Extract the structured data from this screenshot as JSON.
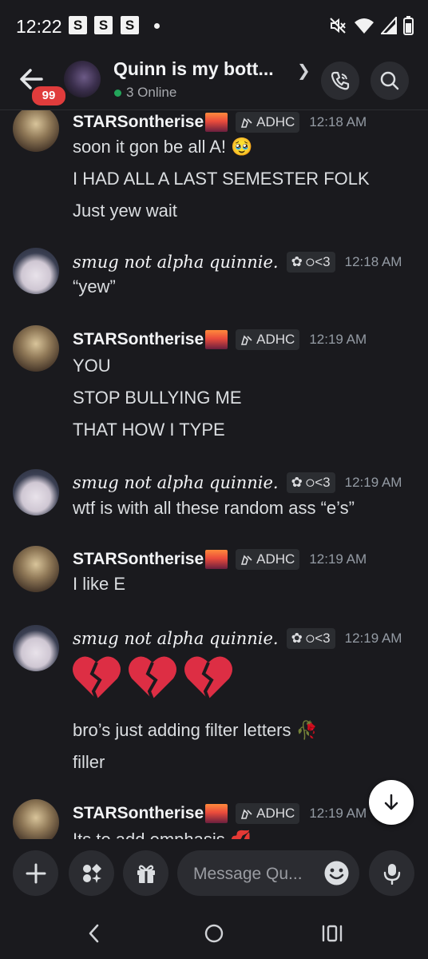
{
  "status_bar": {
    "time": "12:22",
    "notif_letter": "S"
  },
  "header": {
    "unread_count": "99",
    "channel_title": "Quinn is my bott...",
    "online_text": "3 Online"
  },
  "messages": [
    {
      "author": "STARSontherise",
      "tag": "ADHC",
      "time": "12:18 AM",
      "lines": [
        "soon it gon be all A! 🥹",
        "I HAD ALL A LAST SEMESTER FOLK",
        "Just yew wait"
      ]
    },
    {
      "author": "smug not alpha quinnie.",
      "tag": "੦<3",
      "time": "12:18 AM",
      "lines": [
        "“yew”"
      ]
    },
    {
      "author": "STARSontherise",
      "tag": "ADHC",
      "time": "12:19 AM",
      "lines": [
        "YOU",
        "STOP BULLYING ME",
        "THAT HOW I TYPE"
      ]
    },
    {
      "author": "smug not alpha quinnie.",
      "tag": "੦<3",
      "time": "12:19 AM",
      "lines": [
        "wtf is with all these random ass “e’s”"
      ]
    },
    {
      "author": "STARSontherise",
      "tag": "ADHC",
      "time": "12:19 AM",
      "lines": [
        "I like E"
      ]
    },
    {
      "author": "smug not alpha quinnie.",
      "tag": "੦<3",
      "time": "12:19 AM",
      "lines": [
        "bro’s just adding filter letters 🥀",
        "filler"
      ]
    },
    {
      "author": "STARSontherise",
      "tag": "ADHC",
      "time": "12:19 AM",
      "lines": [
        "Its to add emphasis 💋"
      ]
    }
  ],
  "composer": {
    "placeholder": "Message Qu..."
  },
  "colors": {
    "background": "#1a1a1e",
    "badge_red": "#e03c3c",
    "online_green": "#23a55a",
    "heart_red": "#dd2e44"
  },
  "icons": [
    "back-arrow-icon",
    "call-icon",
    "search-icon",
    "plus-icon",
    "apps-icon",
    "gift-icon",
    "emoji-icon",
    "microphone-icon",
    "arrow-down-icon"
  ]
}
